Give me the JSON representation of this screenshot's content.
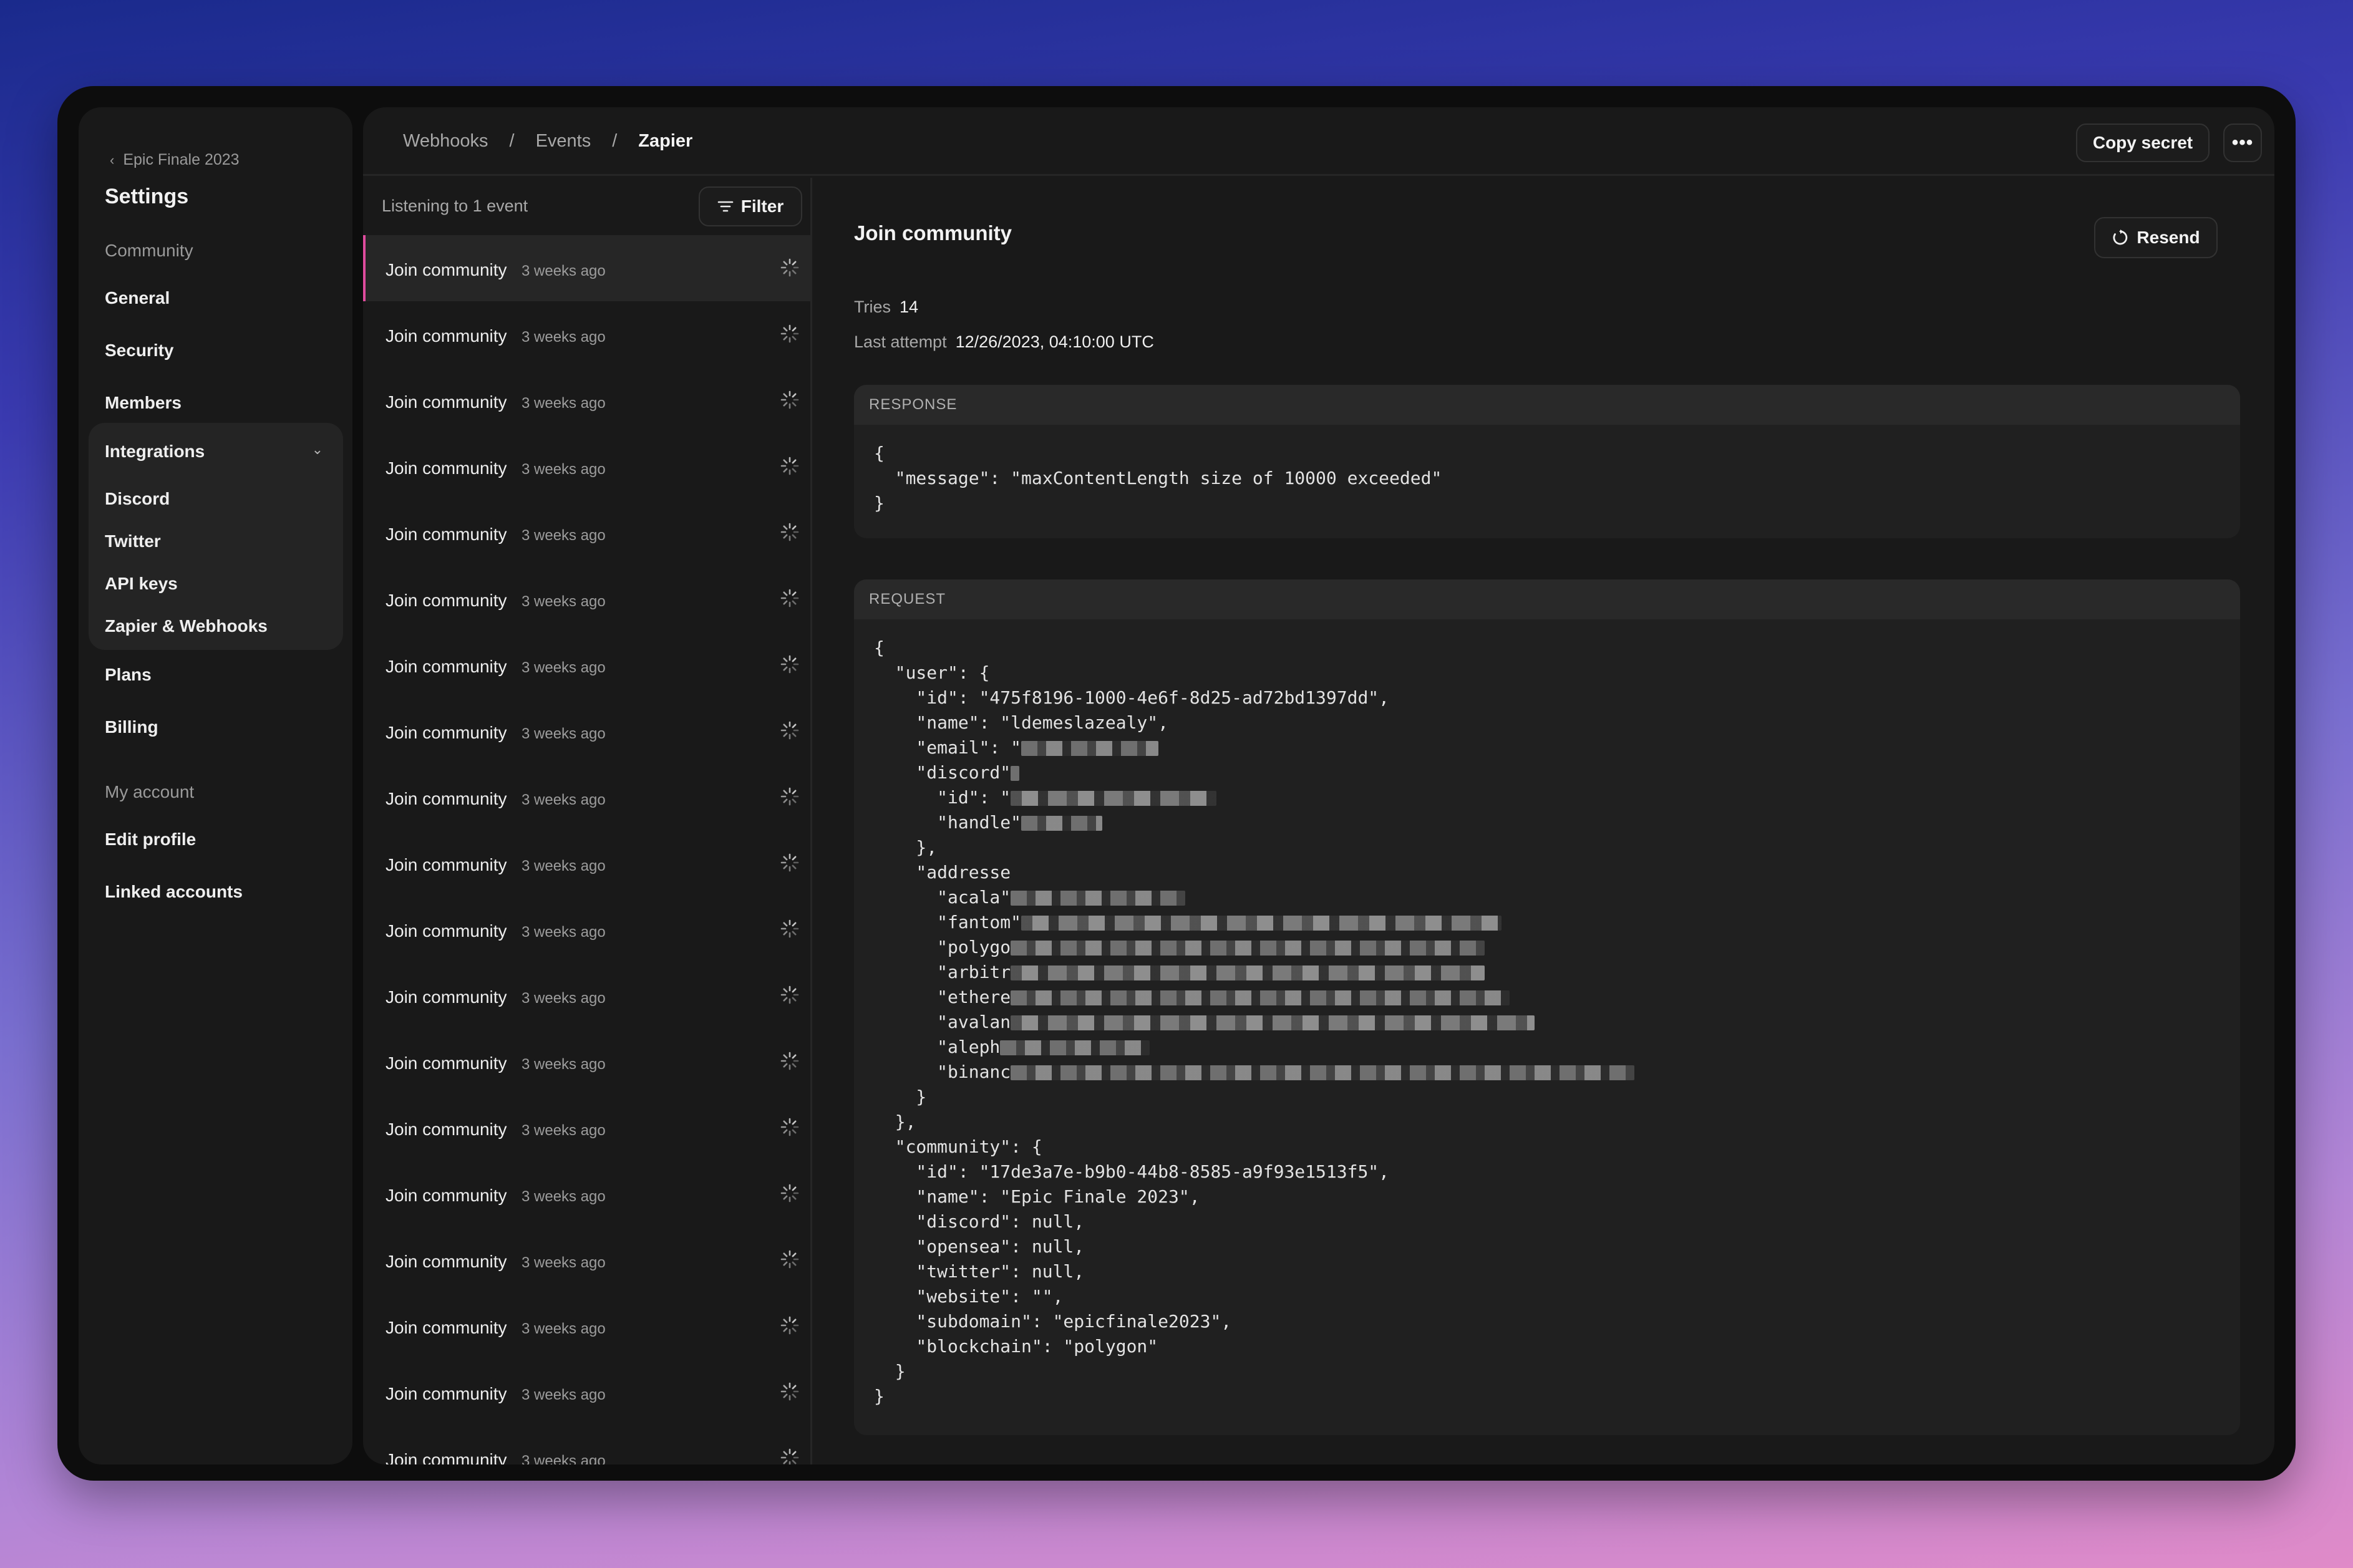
{
  "sidebar": {
    "back_label": "Epic Finale 2023",
    "title": "Settings",
    "community_label": "Community",
    "general": "General",
    "security": "Security",
    "members": "Members",
    "integrations": "Integrations",
    "integrations_items": [
      "Discord",
      "Twitter",
      "API keys",
      "Zapier & Webhooks"
    ],
    "plans": "Plans",
    "billing": "Billing",
    "account_label": "My account",
    "edit_profile": "Edit profile",
    "linked_accounts": "Linked accounts"
  },
  "breadcrumb": [
    "Webhooks",
    "Events",
    "Zapier"
  ],
  "breadcrumb_separator": "/",
  "header": {
    "copy_secret": "Copy secret",
    "more_icon": "ellipsis-icon"
  },
  "list": {
    "listening": "Listening to 1 event",
    "filter": "Filter",
    "events": [
      {
        "name": "Join community",
        "time": "3 weeks ago"
      },
      {
        "name": "Join community",
        "time": "3 weeks ago"
      },
      {
        "name": "Join community",
        "time": "3 weeks ago"
      },
      {
        "name": "Join community",
        "time": "3 weeks ago"
      },
      {
        "name": "Join community",
        "time": "3 weeks ago"
      },
      {
        "name": "Join community",
        "time": "3 weeks ago"
      },
      {
        "name": "Join community",
        "time": "3 weeks ago"
      },
      {
        "name": "Join community",
        "time": "3 weeks ago"
      },
      {
        "name": "Join community",
        "time": "3 weeks ago"
      },
      {
        "name": "Join community",
        "time": "3 weeks ago"
      },
      {
        "name": "Join community",
        "time": "3 weeks ago"
      },
      {
        "name": "Join community",
        "time": "3 weeks ago"
      },
      {
        "name": "Join community",
        "time": "3 weeks ago"
      },
      {
        "name": "Join community",
        "time": "3 weeks ago"
      },
      {
        "name": "Join community",
        "time": "3 weeks ago"
      },
      {
        "name": "Join community",
        "time": "3 weeks ago"
      },
      {
        "name": "Join community",
        "time": "3 weeks ago"
      },
      {
        "name": "Join community",
        "time": "3 weeks ago"
      },
      {
        "name": "Join community",
        "time": "3 weeks ago"
      }
    ]
  },
  "detail": {
    "title": "Join community",
    "resend": "Resend",
    "tries_label": "Tries",
    "tries_value": "14",
    "last_attempt_label": "Last attempt",
    "last_attempt_value": "12/26/2023, 04:10:00 UTC",
    "response_label": "RESPONSE",
    "response_body": "{\n  \"message\": \"maxContentLength size of 10000 exceeded\"\n}",
    "request_label": "REQUEST",
    "request_lines": [
      "{",
      "  \"user\": {",
      "    \"id\": \"475f8196-1000-4e6f-8d25-ad72bd1397dd\",",
      "    \"name\": \"ldemeslazealy\",",
      "    \"email\": \"",
      "    \"discord\"",
      "      \"id\": \"",
      "      \"handle\"",
      "    },",
      "    \"addresse",
      "      \"acala\"",
      "      \"fantom\"",
      "      \"polygo",
      "      \"arbitr",
      "      \"ethere",
      "      \"avalan",
      "      \"aleph",
      "      \"binanc",
      "    }",
      "  },",
      "  \"community\": {",
      "    \"id\": \"17de3a7e-b9b0-44b8-8585-a9f93e1513f5\",",
      "    \"name\": \"Epic Finale 2023\",",
      "    \"discord\": null,",
      "    \"opensea\": null,",
      "    \"twitter\": null,",
      "    \"website\": \"\",",
      "    \"subdomain\": \"epicfinale2023\",",
      "    \"blockchain\": \"polygon\"",
      "  }",
      "}"
    ]
  },
  "colors": {
    "accent": "#e04c9e",
    "background": "#191919"
  }
}
